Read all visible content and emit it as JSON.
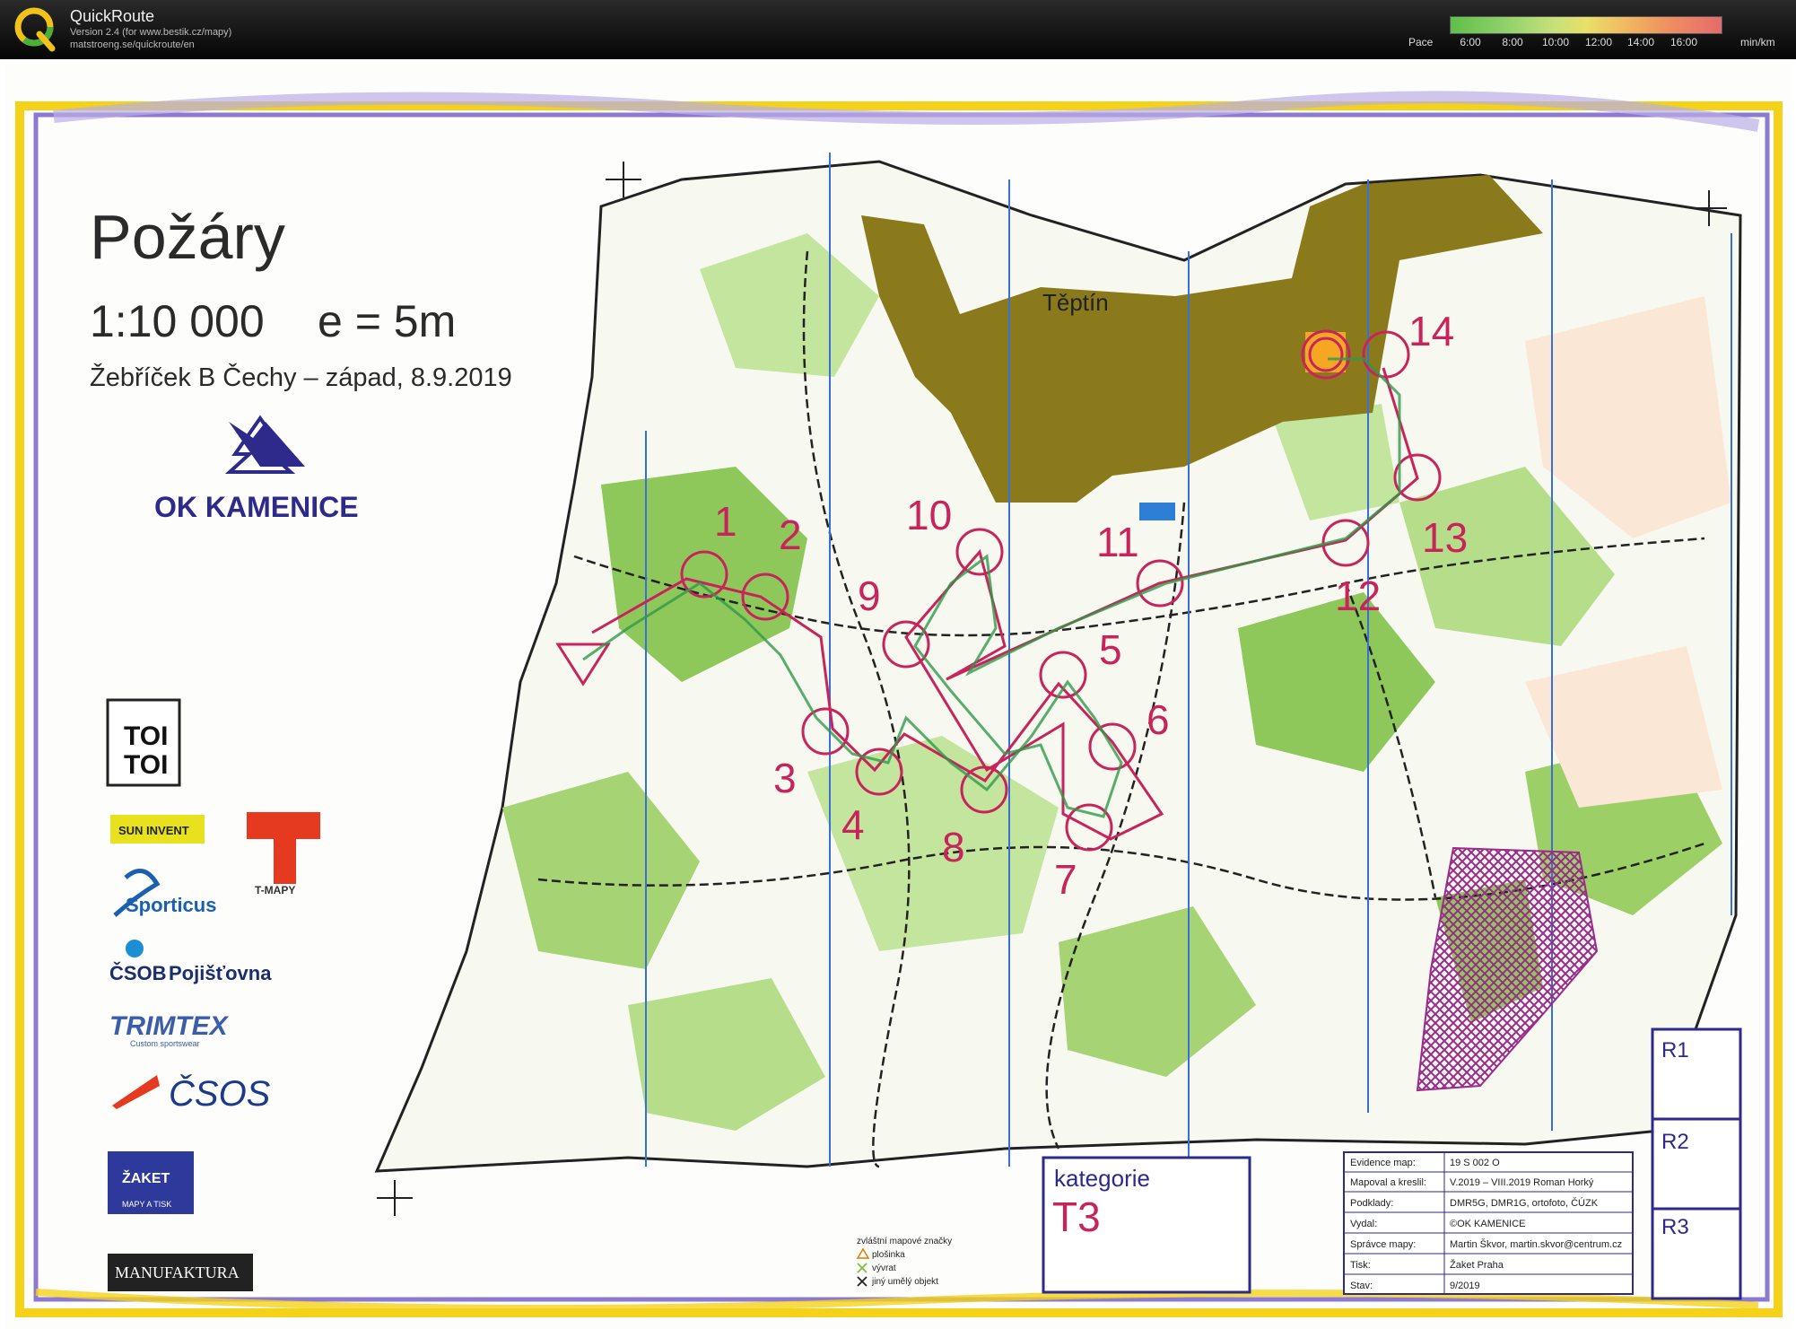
{
  "app": {
    "name": "QuickRoute",
    "version_line": "Version 2.4  (for www.bestik.cz/mapy)",
    "url_line": "matstroeng.se/quickroute/en"
  },
  "pace": {
    "label": "Pace",
    "ticks": [
      "6:00",
      "8:00",
      "10:00",
      "12:00",
      "14:00",
      "16:00"
    ],
    "unit": "min/km"
  },
  "map": {
    "title": "Požáry",
    "scale": "1:10 000",
    "equidistance": "e = 5m",
    "event": "Žebříček B Čechy – západ, 8.9.2019",
    "club": "OK KAMENICE",
    "place_name": "Těptín",
    "controls": [
      "1",
      "2",
      "3",
      "4",
      "5",
      "6",
      "7",
      "8",
      "9",
      "10",
      "11",
      "12",
      "13",
      "14"
    ],
    "category_label": "kategorie",
    "category_value": "T3",
    "legend": {
      "title": "zvláštní mapové značky",
      "items": [
        "plošinka",
        "vývrat",
        "jiný umělý objekt"
      ]
    },
    "info_table": [
      [
        "Evidence map:",
        "19 S 002 O"
      ],
      [
        "Mapoval a kreslil:",
        "V.2019 – VIII.2019 Roman Horký"
      ],
      [
        "Podklady:",
        "DMR5G, DMR1G, ortofoto, ČÚZK"
      ],
      [
        "Vydal:",
        "©OK KAMENICE"
      ],
      [
        "Správce mapy:",
        "Martin Škvor, martin.skvor@centrum.cz"
      ],
      [
        "Tisk:",
        "Žaket Praha"
      ],
      [
        "Stav:",
        "9/2019"
      ]
    ],
    "boxes": [
      "R1",
      "R2",
      "R3"
    ],
    "sponsors": {
      "toitoi": [
        "TOI",
        "TOI"
      ],
      "suninvent": "SUN INVENT",
      "tmapy": "T-MAPY",
      "sporticus": "Sporticus",
      "csob": [
        "ČSOB",
        "Pojišťovna"
      ],
      "trimtex": "TRIMTEX",
      "trimtex_sub": "Custom sportswear",
      "csos": "ČSOS",
      "zaket": [
        "ŽAKET",
        "MAPY A TISK"
      ],
      "manufaktura": "MANUFAKTURA"
    }
  },
  "colors": {
    "course": "#c8245c",
    "forest": "#7fbf3f",
    "forest_light": "#bfe39a",
    "settlement": "#8a7a1c",
    "border_yellow": "#f5d21a",
    "border_purple": "#8c7ad0",
    "club_blue": "#2d2a8c"
  }
}
